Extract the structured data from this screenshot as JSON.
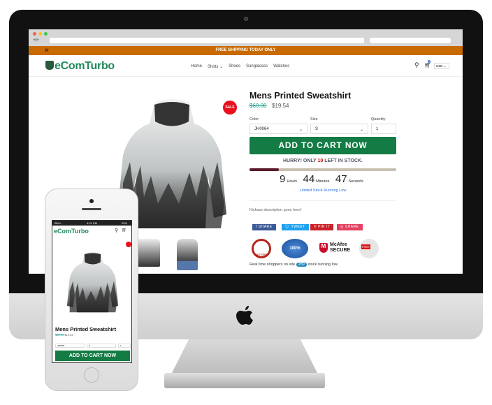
{
  "promo": "FREE SHIPPING TODAY ONLY",
  "brand": "eComTurbo",
  "nav": [
    "Home",
    "Shirts",
    "Shoes",
    "Sunglasses",
    "Watches"
  ],
  "currency": "USD",
  "cart_count": "0",
  "sale_badge": "SALE",
  "product": {
    "title": "Mens Printed Sweatshirt",
    "old_price": "$60.00",
    "price": "$19.54"
  },
  "options": {
    "color_label": "Color",
    "color_value": "JH0064",
    "size_label": "Size",
    "size_value": "S",
    "qty_label": "Quantity",
    "qty_value": "1"
  },
  "add_to_cart": "ADD TO CART NOW",
  "stock": {
    "prefix": "HURRY! ONLY",
    "count": "10",
    "suffix": "LEFT IN STOCK.",
    "progress_percent": 20
  },
  "timer": {
    "hours": "9",
    "hours_label": "Hours",
    "minutes": "44",
    "minutes_label": "Minutes",
    "seconds": "47",
    "seconds_label": "Seconds"
  },
  "limited": "Limited Stock Running Low",
  "description": "Kickass description goes here!",
  "share": [
    {
      "label": "SHARE",
      "color": "#3b5998"
    },
    {
      "label": "TWEET",
      "color": "#1da1f2"
    },
    {
      "label": "PIN IT",
      "color": "#cb2027"
    },
    {
      "label": "SHARE",
      "color": "#e4405f"
    }
  ],
  "trust": {
    "hot": "HOT ITEM",
    "guarantee": "100%",
    "mcafee_1": "McAfee",
    "mcafee_2": "SECURE",
    "shipping": "FREE"
  },
  "realtime": {
    "prefix": "Real time shoppers on site",
    "count": "289",
    "suffix": "stock running low."
  },
  "phone": {
    "carrier": "BELL",
    "time": "4:21 PM",
    "battery": "22%"
  }
}
